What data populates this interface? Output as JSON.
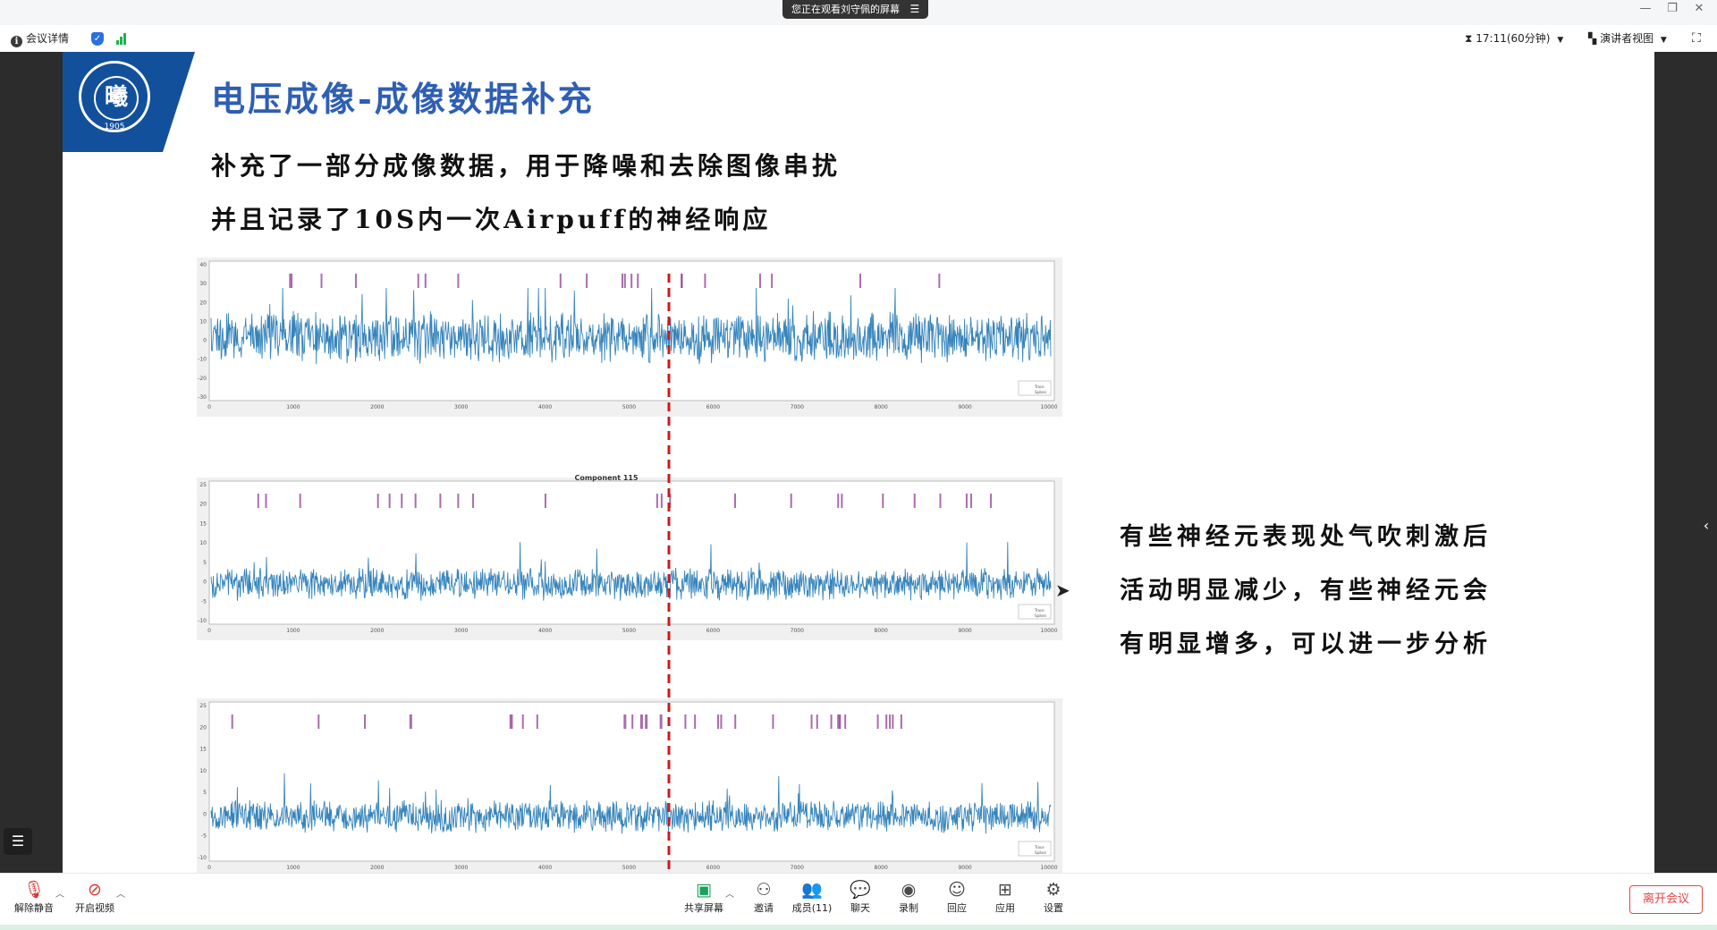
{
  "window": {
    "banner_text": "您正在观看刘守佩的屏幕",
    "banner_menu": "☰",
    "minimize": "—",
    "restore": "❐",
    "close": "✕"
  },
  "toolbar": {
    "meeting_info": "会议详情",
    "timer": "17:11(60分钟)",
    "view_mode": "演讲者视图"
  },
  "slide": {
    "logo_text": "曦",
    "logo_year": "1905",
    "title": "电压成像-成像数据补充",
    "line1": "补充了一部分成像数据，用于降噪和去除图像串扰",
    "line2": "并且记录了10S内一次Airpuff的神经响应",
    "notes": [
      "有些神经元表现处气吹刺激后",
      "活动明显减少，有些神经元会",
      "有明显增多，可以进一步分析"
    ],
    "panel2_title": "Component 115",
    "legend": [
      "Trace",
      "Spikes"
    ],
    "x_ticks": [
      "0",
      "1000",
      "2000",
      "3000",
      "4000",
      "5000",
      "6000",
      "7000",
      "8000",
      "9000",
      "10000"
    ],
    "panels": [
      {
        "y_ticks": [
          "40",
          "30",
          "20",
          "10",
          "0",
          "-10",
          "-20",
          "-30"
        ]
      },
      {
        "y_ticks": [
          "25",
          "20",
          "15",
          "10",
          "5",
          "0",
          "-5",
          "-10"
        ]
      },
      {
        "y_ticks": [
          "25",
          "20",
          "15",
          "10",
          "5",
          "0",
          "-5",
          "-10"
        ]
      }
    ]
  },
  "controls": {
    "unmute": "解除静音",
    "start_video": "开启视频",
    "share_screen": "共享屏幕",
    "invite": "邀请",
    "members": "成员(11)",
    "chat": "聊天",
    "record": "录制",
    "reactions": "回应",
    "apps": "应用",
    "settings": "设置",
    "leave": "离开会议"
  },
  "colors": {
    "trace": "#1f77b4",
    "spikes": "#8e3b92",
    "stim_line": "#cc1a1a",
    "title_blue": "#2f5fb3",
    "logo_blue": "#12509b",
    "leave_red": "#e64343"
  }
}
